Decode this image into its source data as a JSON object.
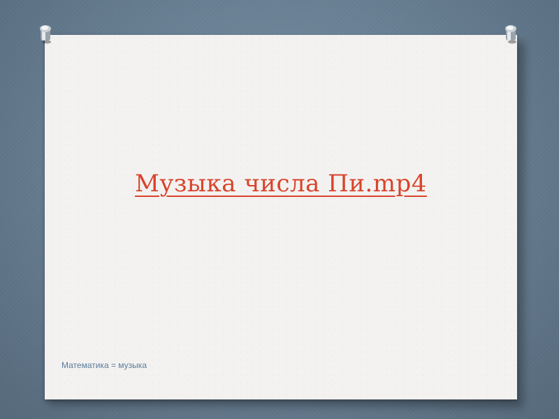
{
  "slide": {
    "title_link": "Музыка числа Пи.mp4",
    "footer_text": "Математика = музыка"
  },
  "colors": {
    "backdrop": "#6a8195",
    "card": "#f3f2f0",
    "title": "#d8432a",
    "footer": "#5a7a9c"
  },
  "icons": {
    "left_pin": "pushpin-icon",
    "right_pin": "pushpin-icon"
  }
}
